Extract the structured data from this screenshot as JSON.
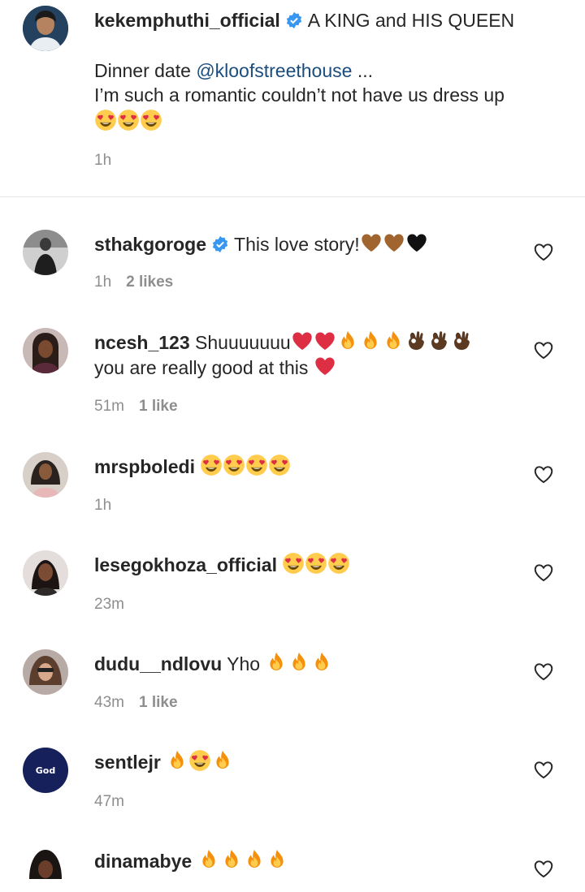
{
  "post": {
    "username": "kekemphuthi_official",
    "title": "A KING and HIS QUEEN",
    "line2_prefix": "Dinner date ",
    "mention": "@kloofstreethouse",
    "ellipsis": " ...",
    "line3": "I’m such a romantic couldn’t not have us dress up",
    "time": "1h"
  },
  "comments": [
    {
      "username": "sthakgoroge",
      "verified": true,
      "text": "This love story!",
      "time": "1h",
      "likes": "2 likes"
    },
    {
      "username": "ncesh_123",
      "text": "Shuuuuuuu",
      "text2": "you are really good at this",
      "time": "51m",
      "likes": "1 like"
    },
    {
      "username": "mrspboledi",
      "text": "",
      "time": "1h",
      "likes": ""
    },
    {
      "username": "lesegokhoza_official",
      "text": "",
      "time": "23m",
      "likes": ""
    },
    {
      "username": "dudu__ndlovu",
      "text": "Yho",
      "time": "43m",
      "likes": "1 like"
    },
    {
      "username": "sentlejr",
      "text": "",
      "time": "47m",
      "likes": "",
      "avatar_text": "God"
    },
    {
      "username": "dinamabye",
      "text": "",
      "time": "",
      "likes": ""
    }
  ],
  "colors": {
    "username": "#262626",
    "meta": "#8e8e8e",
    "mention": "#1a4c7e",
    "verified": "#3897f0",
    "divider": "#e6e6e6"
  }
}
